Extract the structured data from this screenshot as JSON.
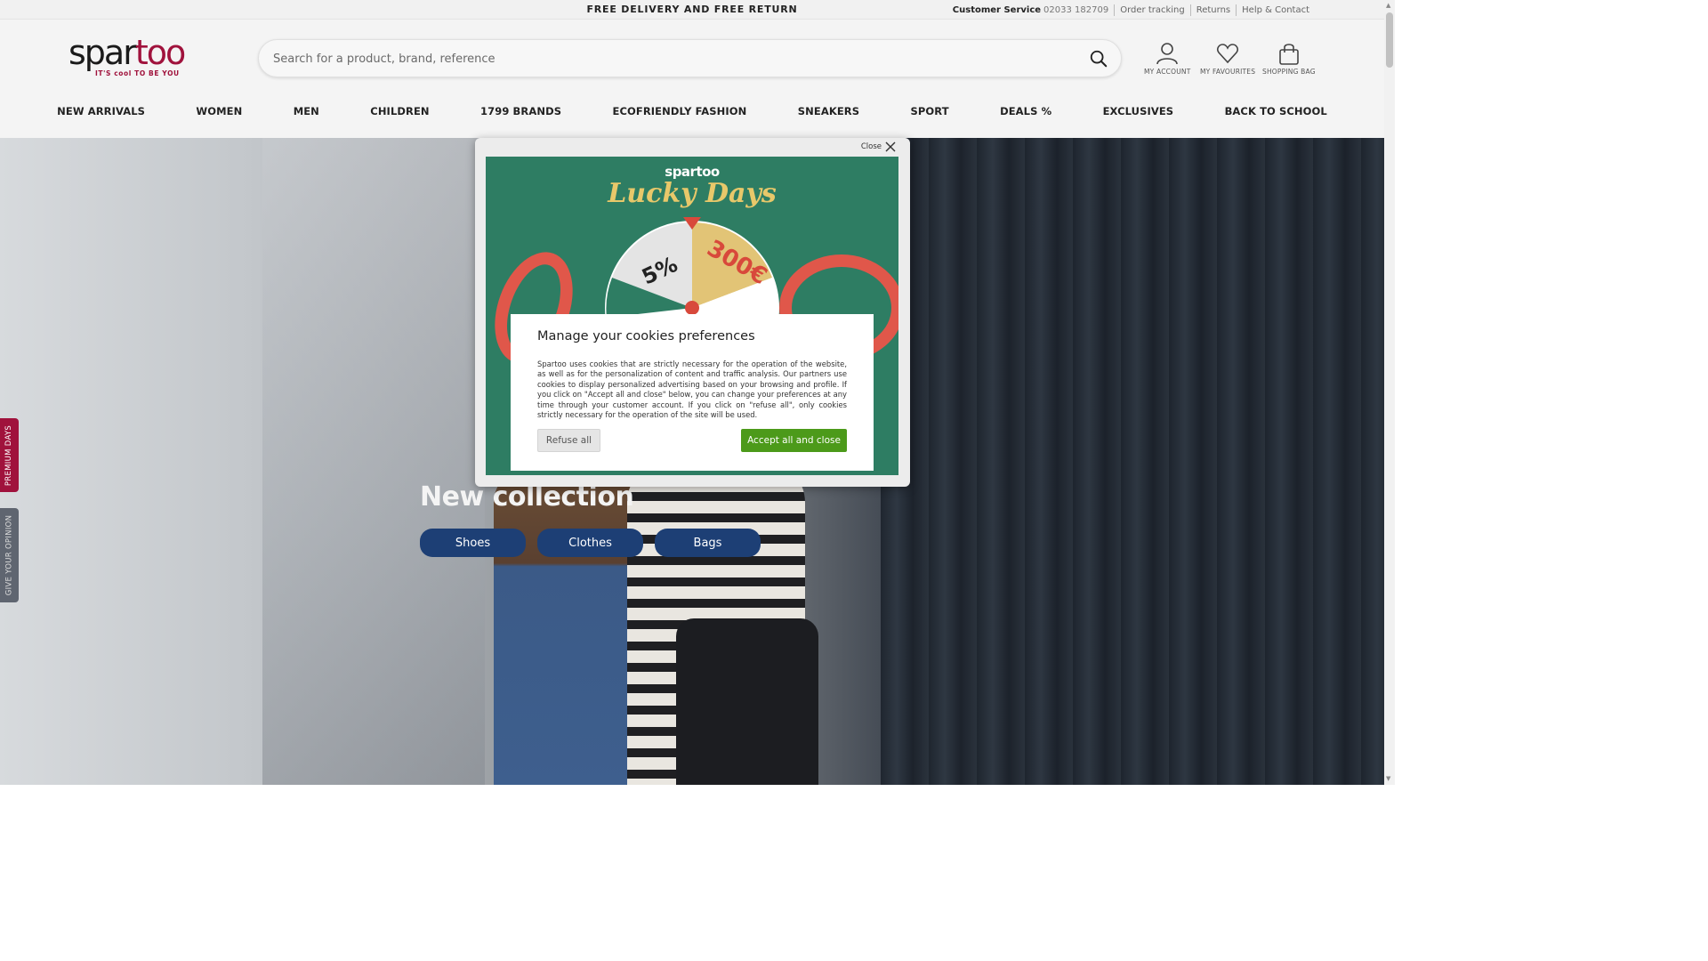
{
  "topbar": {
    "promo": "FREE DELIVERY AND FREE RETURN",
    "customer_service_label": "Customer Service",
    "phone": "02033 182709",
    "links": [
      "Order tracking",
      "Returns",
      "Help & Contact"
    ]
  },
  "header": {
    "logo_word_1": "spar",
    "logo_word_2": "too",
    "logo_tagline": "IT'S cool TO BE YOU",
    "search_placeholder": "Search for a product, brand, reference",
    "account_label": "MY ACCOUNT",
    "favourites_label": "MY FAVOURITES",
    "bag_label": "SHOPPING BAG"
  },
  "nav": {
    "items": [
      "NEW ARRIVALS",
      "WOMEN",
      "MEN",
      "CHILDREN",
      "1799 BRANDS",
      "ECOFRIENDLY FASHION",
      "SNEAKERS",
      "SPORT",
      "DEALS %",
      "EXCLUSIVES",
      "BACK TO SCHOOL"
    ]
  },
  "hero": {
    "title": "New collection",
    "buttons": [
      "Shoes",
      "Clothes",
      "Bags"
    ]
  },
  "side_tabs": {
    "premium": "PREMIUM DAYS",
    "opinion": "GIVE YOUR OPINION"
  },
  "popup": {
    "close_label": "Close",
    "brand": "spartoo",
    "headline": "Lucky Days",
    "wheel_labels": [
      "5%",
      "300€"
    ]
  },
  "cookies": {
    "title": "Manage your cookies preferences",
    "body": "Spartoo uses cookies that are strictly necessary for the operation of the website, as well as for the personalization of content and traffic analysis. Our partners use cookies to display personalized advertising based on your browsing and profile. If you click on \"Accept all and close\" below, you can change your preferences at any time through your customer account. If you click on \"refuse all\", only cookies strictly necessary for the operation of the site will be used.",
    "refuse_label": "Refuse all",
    "accept_label": "Accept all and close"
  },
  "colors": {
    "brand": "#a0123c",
    "hero_button": "#1d3f75",
    "accept_button": "#4c9a1a",
    "promo_green": "#2e7d63"
  }
}
